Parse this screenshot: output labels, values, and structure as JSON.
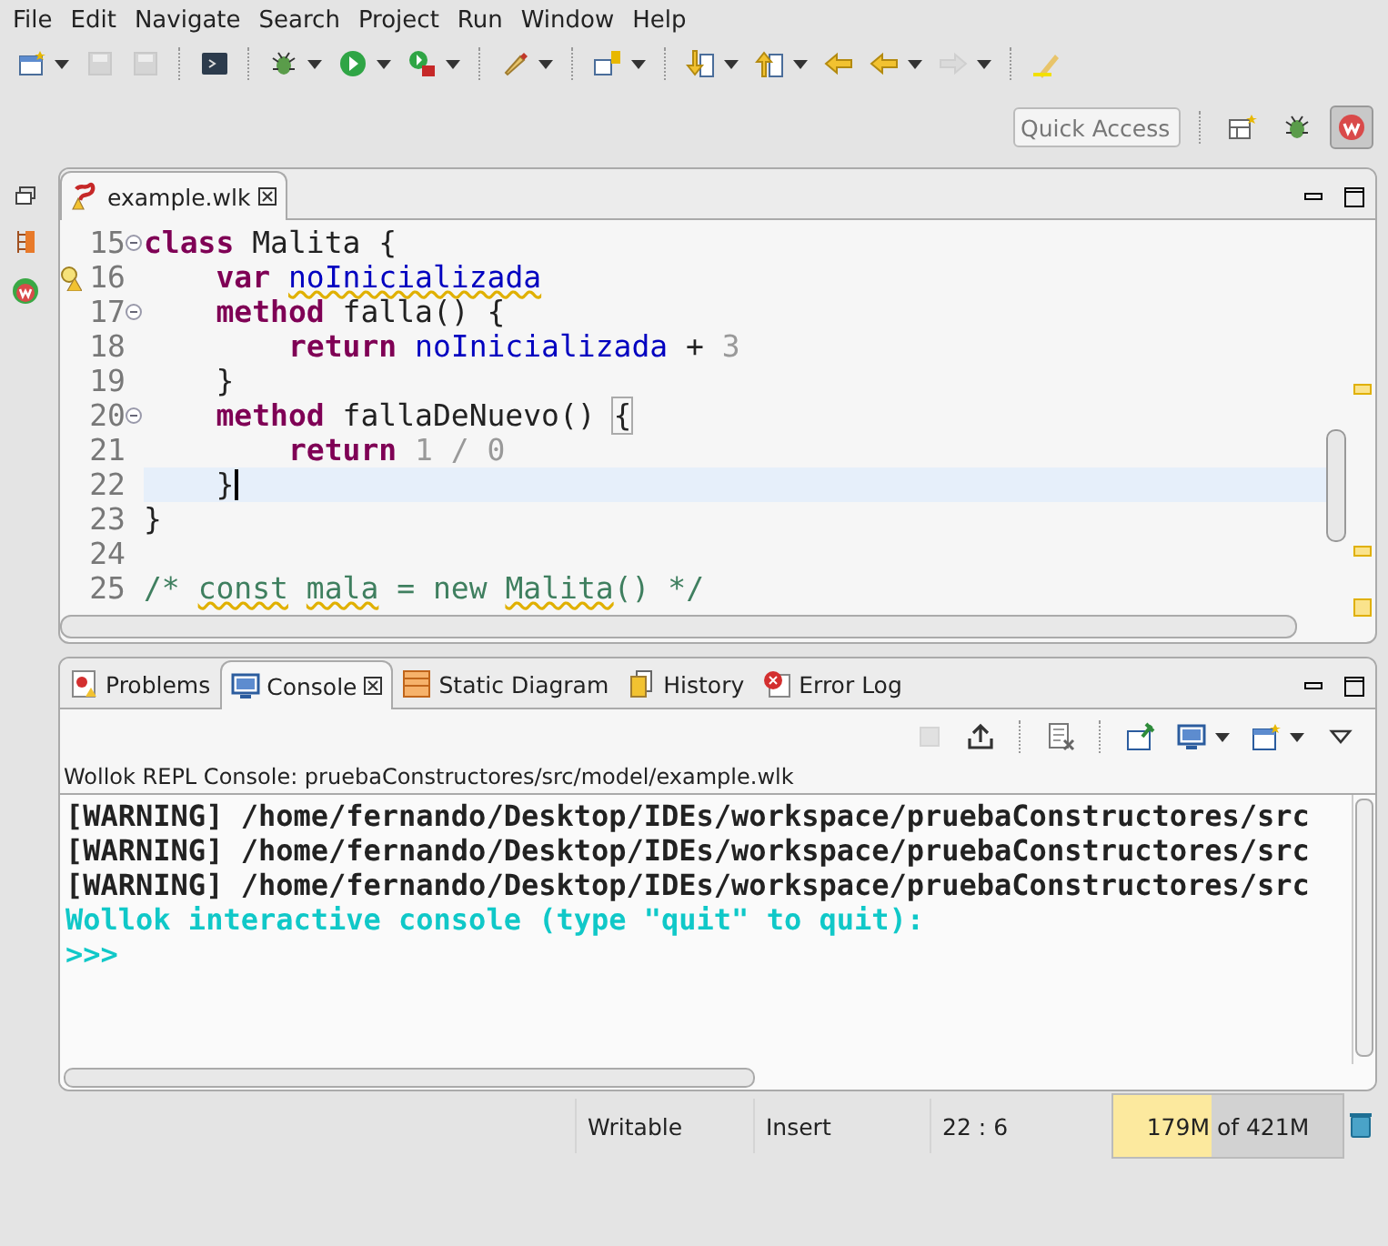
{
  "menu": [
    "File",
    "Edit",
    "Navigate",
    "Search",
    "Project",
    "Run",
    "Window",
    "Help"
  ],
  "toolbar": [
    {
      "kind": "new",
      "dropdown": true,
      "disabled": false
    },
    {
      "kind": "save",
      "dropdown": false,
      "disabled": true
    },
    {
      "kind": "save-all",
      "dropdown": false,
      "disabled": true
    },
    {
      "kind": "separator"
    },
    {
      "kind": "terminal",
      "dropdown": false,
      "disabled": false
    },
    {
      "kind": "separator"
    },
    {
      "kind": "debug",
      "dropdown": true,
      "disabled": false
    },
    {
      "kind": "run",
      "dropdown": true,
      "disabled": false
    },
    {
      "kind": "run-external",
      "dropdown": true,
      "disabled": false
    },
    {
      "kind": "separator"
    },
    {
      "kind": "pen",
      "dropdown": true,
      "disabled": false
    },
    {
      "kind": "separator"
    },
    {
      "kind": "open-type",
      "dropdown": true,
      "disabled": false
    },
    {
      "kind": "separator"
    },
    {
      "kind": "next-annotation",
      "dropdown": true,
      "disabled": false
    },
    {
      "kind": "prev-annotation",
      "dropdown": true,
      "disabled": false
    },
    {
      "kind": "last-edit",
      "dropdown": false,
      "disabled": false
    },
    {
      "kind": "back",
      "dropdown": true,
      "disabled": false
    },
    {
      "kind": "forward",
      "dropdown": true,
      "disabled": true
    },
    {
      "kind": "separator"
    },
    {
      "kind": "highlight",
      "dropdown": false,
      "disabled": false
    }
  ],
  "quick_access": {
    "placeholder": "Quick Access"
  },
  "perspectives": [
    {
      "kind": "open-perspective",
      "selected": false
    },
    {
      "kind": "debug",
      "selected": false
    },
    {
      "kind": "wollok",
      "selected": true
    }
  ],
  "editor": {
    "tab": {
      "label": "example.wlk"
    },
    "lines": [
      {
        "number": "15",
        "fold": true,
        "warning": false,
        "current": false,
        "tokens": [
          {
            "kind": "keyword",
            "text": "class"
          },
          {
            "kind": "plain",
            "text": " Malita {"
          }
        ]
      },
      {
        "number": "16",
        "fold": false,
        "warning": true,
        "current": false,
        "tokens": [
          {
            "kind": "keyword",
            "text": "    var"
          },
          {
            "kind": "field",
            "text": " noInicializada",
            "squiggle": true
          }
        ]
      },
      {
        "number": "17",
        "fold": true,
        "warning": false,
        "current": false,
        "tokens": [
          {
            "kind": "keyword",
            "text": "    method"
          },
          {
            "kind": "plain",
            "text": " falla() {"
          }
        ]
      },
      {
        "number": "18",
        "fold": false,
        "warning": false,
        "current": false,
        "tokens": [
          {
            "kind": "keyword",
            "text": "        return"
          },
          {
            "kind": "field",
            "text": " noInicializada"
          },
          {
            "kind": "plain",
            "text": " + "
          },
          {
            "kind": "number",
            "text": "3"
          }
        ]
      },
      {
        "number": "19",
        "fold": false,
        "warning": false,
        "current": false,
        "tokens": [
          {
            "kind": "plain",
            "text": "    }"
          }
        ]
      },
      {
        "number": "20",
        "fold": true,
        "warning": false,
        "current": false,
        "tokens": [
          {
            "kind": "keyword",
            "text": "    method"
          },
          {
            "kind": "plain",
            "text": " fallaDeNuevo() "
          },
          {
            "kind": "bracket",
            "text": "{"
          }
        ]
      },
      {
        "number": "21",
        "fold": false,
        "warning": false,
        "current": false,
        "tokens": [
          {
            "kind": "keyword",
            "text": "        return"
          },
          {
            "kind": "number",
            "text": " 1 / 0"
          }
        ]
      },
      {
        "number": "22",
        "fold": false,
        "warning": false,
        "current": true,
        "tokens": [
          {
            "kind": "plain",
            "text": "    }"
          }
        ]
      },
      {
        "number": "23",
        "fold": false,
        "warning": false,
        "current": false,
        "tokens": [
          {
            "kind": "plain",
            "text": "}"
          }
        ]
      },
      {
        "number": "24",
        "fold": false,
        "warning": false,
        "current": false
      },
      {
        "number": "25",
        "fold": false,
        "warning": false,
        "current": false,
        "tokens": [
          {
            "kind": "comment",
            "text": "/* "
          },
          {
            "kind": "comment",
            "text": "const",
            "squiggle": true
          },
          {
            "kind": "comment",
            "text": " mala",
            "squiggle": true
          },
          {
            "kind": "comment",
            "text": " = new "
          },
          {
            "kind": "comment",
            "text": "Malita",
            "squiggle": true
          },
          {
            "kind": "comment",
            "text": "() */"
          }
        ]
      }
    ]
  },
  "bottom_tabs": [
    {
      "kind": "problems",
      "label": "Problems",
      "selected": false
    },
    {
      "kind": "console",
      "label": "Console",
      "selected": true
    },
    {
      "kind": "diagram",
      "label": "Static Diagram",
      "selected": false
    },
    {
      "kind": "history",
      "label": "History",
      "selected": false
    },
    {
      "kind": "error-log",
      "label": "Error Log",
      "selected": false
    }
  ],
  "console_toolbar": [
    {
      "kind": "stop",
      "dropdown": false,
      "disabled": true
    },
    {
      "kind": "export",
      "dropdown": false,
      "disabled": false
    },
    {
      "kind": "separator"
    },
    {
      "kind": "clear",
      "dropdown": false,
      "disabled": false
    },
    {
      "kind": "separator"
    },
    {
      "kind": "pin",
      "dropdown": false,
      "disabled": false
    },
    {
      "kind": "display",
      "dropdown": true,
      "disabled": false
    },
    {
      "kind": "new-console",
      "dropdown": true,
      "disabled": false
    },
    {
      "kind": "view-menu",
      "dropdown": false,
      "disabled": false
    }
  ],
  "console": {
    "title": "Wollok REPL Console: pruebaConstructores/src/model/example.wlk",
    "lines": [
      {
        "kind": "output",
        "text": "[WARNING] /home/fernando/Desktop/IDEs/workspace/pruebaConstructores/src"
      },
      {
        "kind": "output",
        "text": "[WARNING] /home/fernando/Desktop/IDEs/workspace/pruebaConstructores/src"
      },
      {
        "kind": "output",
        "text": "[WARNING] /home/fernando/Desktop/IDEs/workspace/pruebaConstructores/src"
      },
      {
        "kind": "prompt",
        "text": "Wollok interactive console (type \"quit\" to quit):"
      },
      {
        "kind": "prompt",
        "text": ">>>"
      }
    ]
  },
  "status_bar": {
    "writable": "Writable",
    "mode": "Insert",
    "position": "22 : 6",
    "memory": {
      "text": "179M of 421M",
      "level": 0.425
    }
  }
}
